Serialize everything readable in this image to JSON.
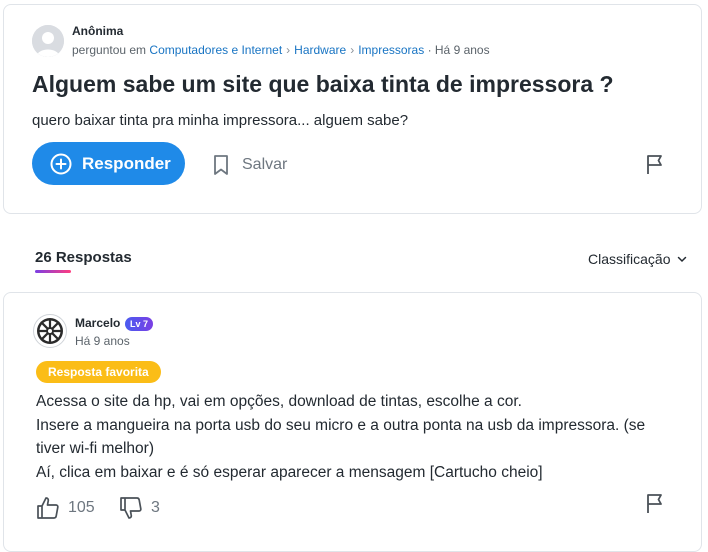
{
  "question": {
    "author": "Anônima",
    "asked_label": "perguntou em",
    "breadcrumbs": [
      "Computadores e Internet",
      "Hardware",
      "Impressoras"
    ],
    "time": "· Há 9 anos",
    "title": "Alguem sabe um site que baixa tinta de impressora ?",
    "body": "quero baixar tinta pra minha impressora... alguem sabe?",
    "answer_button": "Responder",
    "save_button": "Salvar"
  },
  "answers_header": {
    "count_label": "26 Respostas",
    "sort_label": "Classificação"
  },
  "answer": {
    "author": "Marcelo",
    "level": "Lv 7",
    "time": "Há 9 anos",
    "badge": "Resposta favorita",
    "lines": [
      "Acessa o site da hp, vai em opções, download de tintas, escolhe a cor.",
      "Insere a mangueira na porta usb do seu micro e a outra ponta na usb da impressora. (se tiver wi-fi melhor)",
      "Aí, clica em baixar e é só esperar aparecer a mensagem [Cartucho cheio]"
    ],
    "likes": "105",
    "dislikes": "3"
  },
  "colors": {
    "accent": "#1f8ae8",
    "link": "#1874c3",
    "favorite": "#fbbd17",
    "level_badge": "#5a4ef0"
  },
  "icons": [
    "user-avatar-icon",
    "plus-circle-icon",
    "bookmark-icon",
    "flag-icon",
    "chevron-down-icon",
    "empire-avatar-icon",
    "thumbs-up-icon",
    "thumbs-down-icon"
  ]
}
